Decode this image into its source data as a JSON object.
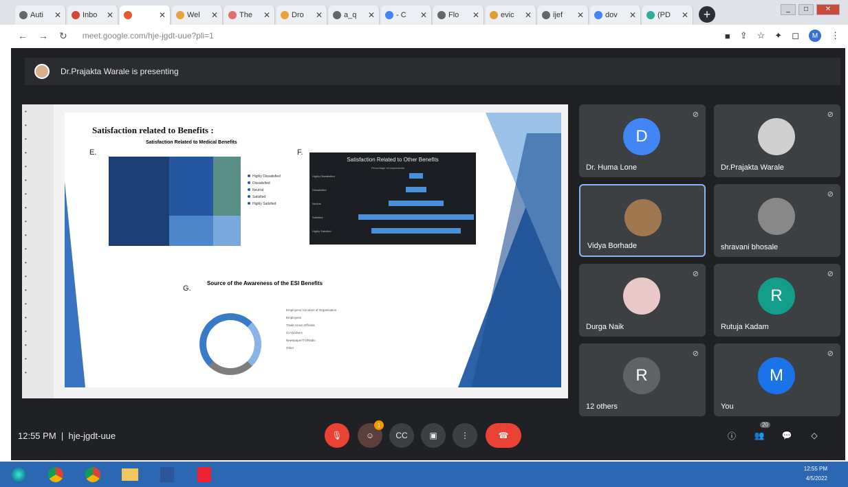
{
  "browser": {
    "tabs": [
      {
        "title": "Auti",
        "fav": "#666"
      },
      {
        "title": "Inbo",
        "fav": "#d14836"
      },
      {
        "title": "",
        "fav": "#e55a2b"
      },
      {
        "title": "Wel",
        "fav": "#e8a33d"
      },
      {
        "title": "The",
        "fav": "#e07070"
      },
      {
        "title": "Dro",
        "fav": "#e8a33d"
      },
      {
        "title": "a_q",
        "fav": "#666"
      },
      {
        "title": "- C",
        "fav": "#4285f4"
      },
      {
        "title": "Flo",
        "fav": "#666"
      },
      {
        "title": "evic",
        "fav": "#e0a030"
      },
      {
        "title": "ijef",
        "fav": "#666"
      },
      {
        "title": "dov",
        "fav": "#4285f4"
      },
      {
        "title": "(PD",
        "fav": "#3a9"
      }
    ],
    "url": "meet.google.com/hje-jgdt-uue?pli=1",
    "profile": "M"
  },
  "meet": {
    "presenting": "Dr.Prajakta Warale is presenting",
    "time": "12:55 PM",
    "code": "hje-jgdt-uue",
    "people_count": "20",
    "reaction_badge": "1"
  },
  "slide": {
    "title": "Satisfaction related to Benefits :",
    "sec_e": "E.",
    "sec_f": "F.",
    "sec_g": "G.",
    "e_title": "Satisfaction Related to Medical Benefits",
    "f_title": "Satisfaction Related to Other Benefits",
    "g_title": "Source of the Awareness of the ESI Benefits",
    "e_legend": [
      "Highly Dissatisfied",
      "Dissatisfied",
      "Neutral",
      "Satisfied",
      "Highly Satisfied"
    ],
    "f_legend": "Percentage of respondents",
    "f_rows": [
      "Highly Dissatisfied",
      "Dissatisfied",
      "Neutral",
      "Satisfied",
      "Highly Satisfied"
    ],
    "g_legend": [
      "Employers/ Circulars of Organisation",
      "Employees",
      "Trade Union Officials",
      "Co-Workers",
      "Newspaper/TV/Radio",
      "Other"
    ]
  },
  "participants": [
    {
      "name": "Dr. Huma Lone",
      "initial": "D",
      "color": "#4285f4"
    },
    {
      "name": "Dr.Prajakta Warale",
      "initial": "",
      "color": "#cfcfcf"
    },
    {
      "name": "Vidya Borhade",
      "initial": "",
      "color": "#a07850"
    },
    {
      "name": "shravani bhosale",
      "initial": "",
      "color": "#888"
    },
    {
      "name": "Durga Naik",
      "initial": "",
      "color": "#e8c8c8"
    },
    {
      "name": "Rutuja Kadam",
      "initial": "R",
      "color": "#129e8a"
    },
    {
      "name": "12 others",
      "initial": "R",
      "color": "#5f6368"
    },
    {
      "name": "You",
      "initial": "M",
      "color": "#1a73e8"
    }
  ],
  "taskbar": {
    "time": "12:55 PM",
    "date": "4/5/2022"
  }
}
